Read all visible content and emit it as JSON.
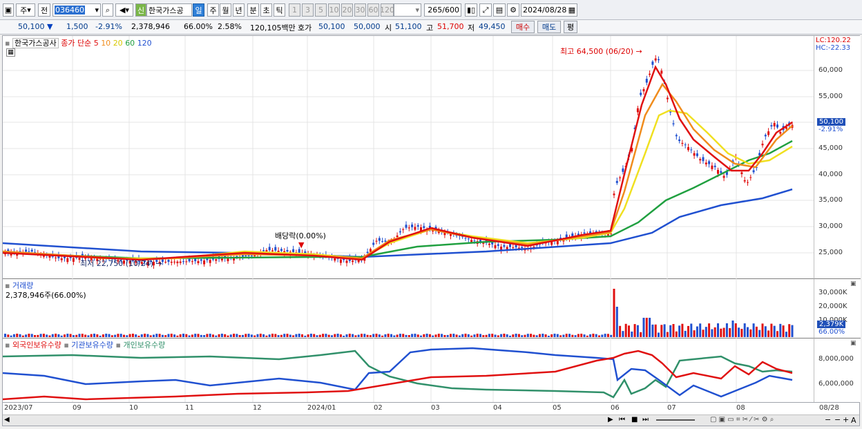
{
  "toolbar": {
    "market_toggle": "주",
    "prev_toggle": "전",
    "code": "036460",
    "new_badge": "신",
    "stock_name": "한국가스공",
    "periods": [
      "일",
      "주",
      "월",
      "년",
      "분",
      "초",
      "틱"
    ],
    "intervals": [
      "1",
      "3",
      "5",
      "10",
      "20",
      "30",
      "60",
      "120"
    ],
    "bar_count": "265",
    "bar_max": "/600",
    "date": "2024/08/28"
  },
  "quote": {
    "price": "50,100",
    "change_arrow": "▼",
    "change": "1,500",
    "change_pct": "-2.91%",
    "volume": "2,378,946",
    "vol_ratio": "66.00%",
    "turnover": "2.58%",
    "amount": "120,105백만",
    "ask_label": "호가",
    "ask": "50,100",
    "bid": "50,000",
    "open_label": "시",
    "open": "51,100",
    "high_label": "고",
    "high": "51,700",
    "low_label": "저",
    "low": "49,450",
    "buy_btn": "매수",
    "sell_btn": "매도",
    "eval_btn": "평"
  },
  "price_panel": {
    "name": "한국가스공사",
    "ma_label": "종가 단순",
    "ma_periods": [
      "5",
      "10",
      "20",
      "60",
      "120"
    ],
    "lc": "LC:120.22",
    "hc": "HC:-22.33",
    "high_note": "최고 64,500 (06/20)",
    "low_note": "최저 22,750 (10/24)",
    "dividend_note": "배당락(0.00%)",
    "y_ticks": [
      "60,000",
      "55,000",
      "50,000",
      "45,000",
      "40,000",
      "35,000",
      "30,000",
      "25,000"
    ],
    "last_tag": "50,100",
    "last_pct": "-2.91%"
  },
  "volume_panel": {
    "title": "거래량",
    "value": "2,378,946주(66.00%)",
    "y_ticks": [
      "30,000K",
      "20,000K",
      "10,000K"
    ],
    "last_tag": "2,379K",
    "last_pct": "66.00%"
  },
  "holding_panel": {
    "series": [
      "외국인보유수량",
      "기관보유수량",
      "개인보유수량"
    ],
    "y_ticks": [
      "8,000,000",
      "6,000,000"
    ]
  },
  "x_axis": [
    "2023/07",
    "09",
    "10",
    "11",
    "12",
    "2024/01",
    "02",
    "03",
    "04",
    "05",
    "06",
    "07",
    "08",
    "08/28"
  ],
  "colors": {
    "ma5": "#e01010",
    "ma10": "#f08c1c",
    "ma20": "#f0e020",
    "ma60": "#20a040",
    "ma120": "#2050d0",
    "foreign": "#e01010",
    "inst": "#2050d0",
    "retail": "#30906a"
  }
}
